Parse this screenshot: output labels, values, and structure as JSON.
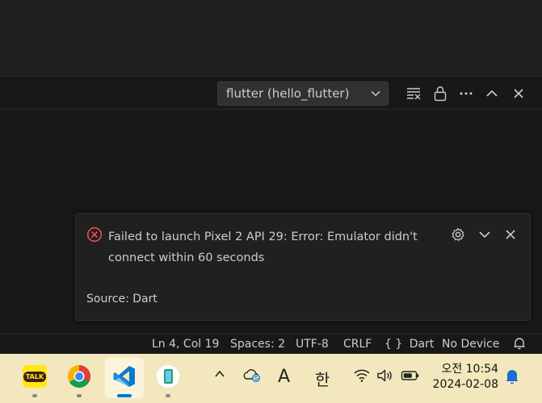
{
  "panel": {
    "channel": "flutter (hello_flutter)"
  },
  "notification": {
    "message_line1": "Failed to launch Pixel 2 API 29: Error: Emulator didn't",
    "message_line2": "connect within 60 seconds",
    "source": "Source: Dart"
  },
  "status_bar": {
    "cursor": "Ln 4, Col 19",
    "spaces": "Spaces: 2",
    "encoding": "UTF-8",
    "eol": "CRLF",
    "language_icon": "{ }",
    "language": "Dart",
    "device": "No Device"
  },
  "taskbar": {
    "kakaotalk_label": "TALK",
    "ime_letter": "A",
    "ime_hangul": "한",
    "time": "오전 10:54",
    "date": "2024-02-08"
  },
  "colors": {
    "error": "#f14c4c",
    "accent": "#0078d4",
    "taskbar": "#f3e8bd"
  },
  "icons": {
    "error": "error-circle-icon",
    "settings": "gear-icon",
    "collapse": "chevron-down-icon",
    "close": "close-icon",
    "clear": "clear-output-icon",
    "lock": "lock-icon",
    "more": "more-actions-icon",
    "maximize": "chevron-up-icon",
    "bell": "bell-icon"
  }
}
